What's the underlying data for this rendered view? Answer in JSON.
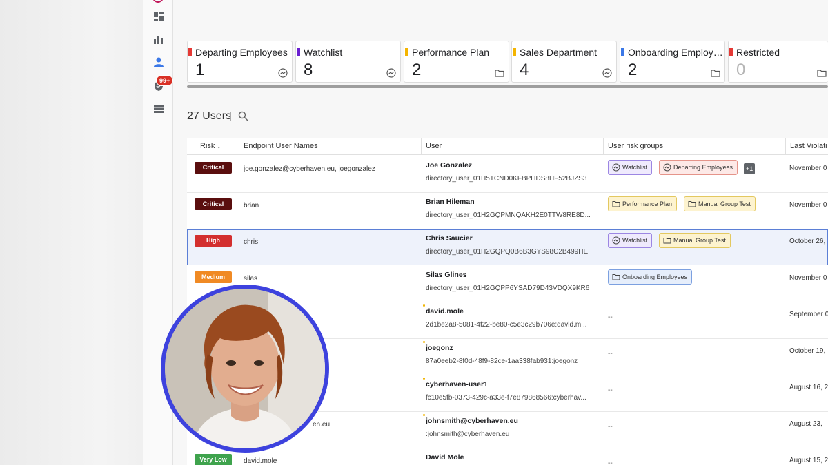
{
  "nav": {
    "notification_badge": "99+",
    "icons": [
      "dashboard-icon",
      "bar-chart-icon",
      "person-icon",
      "shield-check-icon",
      "list-icon"
    ]
  },
  "risk_groups": [
    {
      "title": "Departing Employees",
      "count": "1",
      "color": "#e53935",
      "icon": "dynamic-group-icon"
    },
    {
      "title": "Watchlist",
      "count": "8",
      "color": "#6a1fd1",
      "icon": "dynamic-group-icon"
    },
    {
      "title": "Performance Plan",
      "count": "2",
      "color": "#f4b400",
      "icon": "folder-icon"
    },
    {
      "title": "Sales Department",
      "count": "4",
      "color": "#f4b400",
      "icon": "dynamic-group-icon"
    },
    {
      "title": "Onboarding Employees",
      "count": "2",
      "color": "#3b78e7",
      "icon": "folder-icon"
    },
    {
      "title": "Restricted",
      "count": "0",
      "color": "#e53935",
      "icon": "folder-icon"
    }
  ],
  "users": {
    "count_label": "27 Users"
  },
  "table": {
    "columns": [
      "Risk",
      "Endpoint User Names",
      "User",
      "User risk groups",
      "Last Violati"
    ],
    "rows": [
      {
        "risk": "Critical",
        "endpoint": "joe.gonzalez@cyberhaven.eu, joegonzalez",
        "user_name": "Joe Gonzalez",
        "user_id": "directory_user_01H5TCND0KFBPHDS8HF52BJZS3",
        "groups": [
          "Watchlist",
          "Departing Employees"
        ],
        "more": "+1",
        "date": "November 0"
      },
      {
        "risk": "Critical",
        "endpoint": "brian",
        "user_name": "Brian Hileman",
        "user_id": "directory_user_01H2GQPMNQAKH2E0TTW8RE8D...",
        "groups": [
          "Performance Plan",
          "Manual Group Test"
        ],
        "date": "November 0"
      },
      {
        "risk": "High",
        "endpoint": "chris",
        "user_name": "Chris Saucier",
        "user_id": "directory_user_01H2GQPQ0B6B3GYS98C2B499HE",
        "groups": [
          "Watchlist",
          "Manual Group Test"
        ],
        "date": "October 26,"
      },
      {
        "risk": "Medium",
        "endpoint": "silas",
        "user_name": "Silas Glines",
        "user_id": "directory_user_01H2GQPP6YSAD79D43VDQX9KR6",
        "groups": [
          "Onboarding Employees"
        ],
        "date": "November 0"
      },
      {
        "risk": "",
        "endpoint": "",
        "user_name": "david.mole",
        "user_id": "2d1be2a8-5081-4f22-be80-c5e3c29b706e:david.m...",
        "groups": [],
        "empty": "--",
        "date": "September 0"
      },
      {
        "risk": "",
        "endpoint": "",
        "user_name": "joegonz",
        "user_id": "87a0eeb2-8f0d-48f9-82ce-1aa338fab931:joegonz",
        "groups": [],
        "empty": "--",
        "date": "October 19,"
      },
      {
        "risk": "",
        "endpoint": "",
        "user_name": "cyberhaven-user1",
        "user_id": "fc10e5fb-0373-429c-a33e-f7e879868566:cyberhav...",
        "groups": [],
        "empty": "--",
        "date": "August 16, 2"
      },
      {
        "risk": "",
        "endpoint": "en.eu",
        "user_name": "johnsmith@cyberhaven.eu",
        "user_id": ":johnsmith@cyberhaven.eu",
        "groups": [],
        "empty": "--",
        "date": "August 23,"
      },
      {
        "risk": "Very Low",
        "endpoint": "david.mole",
        "user_name": "David Mole",
        "user_id": "",
        "groups": [],
        "empty": "--",
        "date": "August 15, 2"
      }
    ]
  },
  "colors": {
    "Critical": "#5a0e0e",
    "High": "#d32f2f",
    "Medium": "#f08a24",
    "Very Low": "#3fa34d",
    "avatar_ring": "#3d42de"
  }
}
